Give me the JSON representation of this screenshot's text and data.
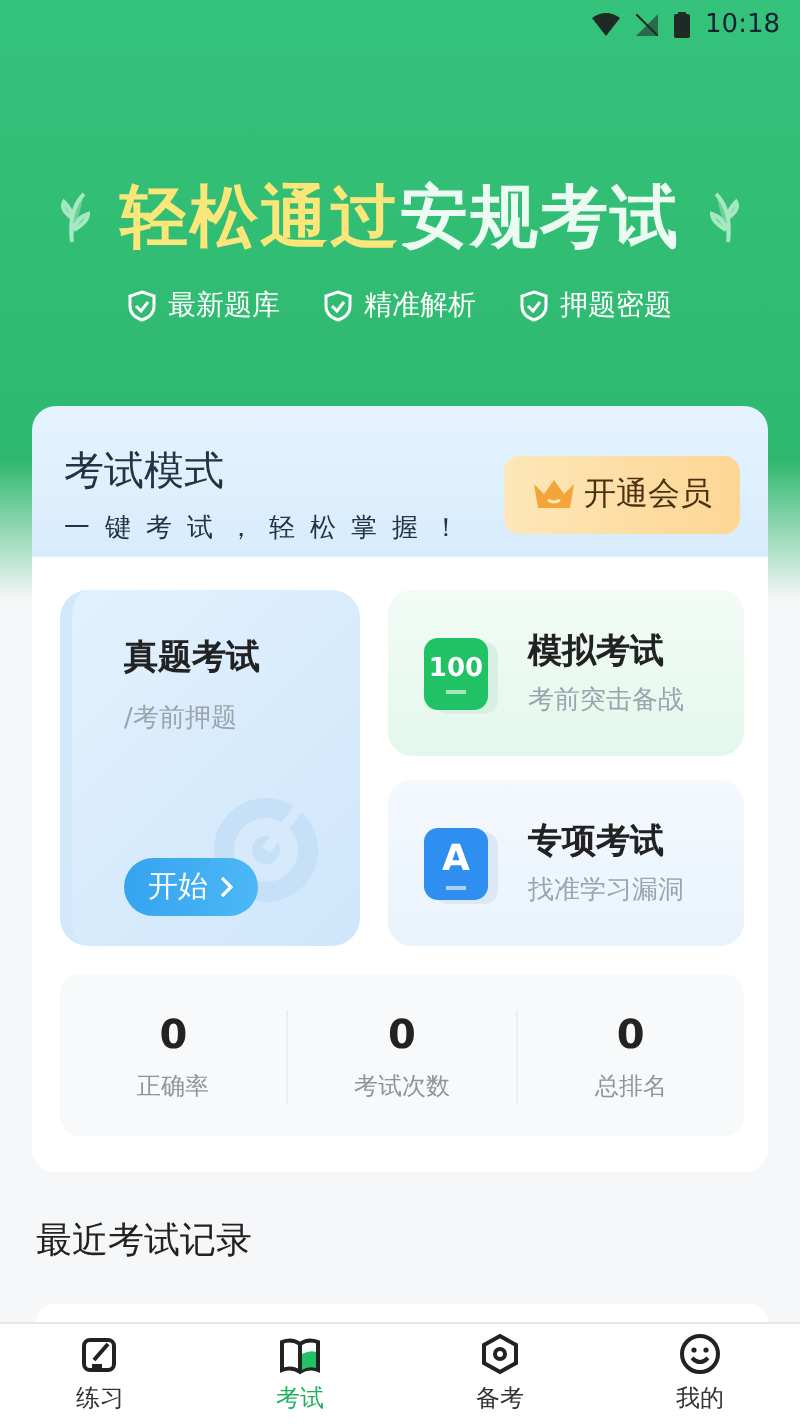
{
  "status_bar": {
    "time": "10:18"
  },
  "hero": {
    "headline": [
      {
        "text": "轻松通过",
        "kind": "highlight"
      },
      {
        "text": "安规考试",
        "kind": "plain"
      }
    ],
    "features": [
      "最新题库",
      "精准解析",
      "押题密题"
    ]
  },
  "exam_mode": {
    "title": "考试模式",
    "subtitle": "一键考试，轻松掌握！",
    "vip_button": "开通会员",
    "main_card": {
      "title": "真题考试",
      "subtitle": "/考前押题",
      "button": "开始"
    },
    "cards": [
      {
        "kind": "mock",
        "badge": "100",
        "title": "模拟考试",
        "subtitle": "考前突击备战"
      },
      {
        "kind": "special",
        "badge": "A",
        "title": "专项考试",
        "subtitle": "找准学习漏洞"
      }
    ],
    "stats": [
      {
        "value": "0",
        "label": "正确率"
      },
      {
        "value": "0",
        "label": "考试次数"
      },
      {
        "value": "0",
        "label": "总排名"
      }
    ]
  },
  "recent": {
    "title": "最近考试记录"
  },
  "nav": [
    {
      "label": "练习",
      "selected": false
    },
    {
      "label": "考试",
      "selected": true
    },
    {
      "label": "备考",
      "selected": false
    },
    {
      "label": "我的",
      "selected": false
    }
  ]
}
